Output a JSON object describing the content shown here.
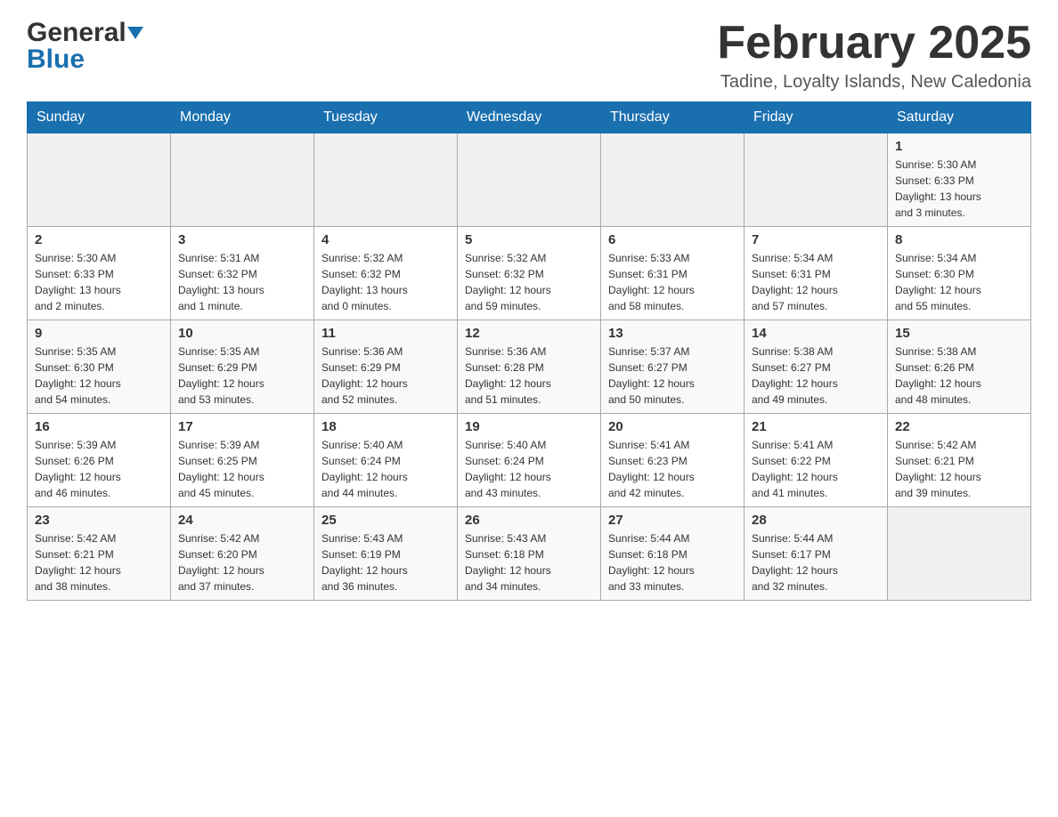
{
  "header": {
    "logo_general": "General",
    "logo_blue": "Blue",
    "month_title": "February 2025",
    "location": "Tadine, Loyalty Islands, New Caledonia"
  },
  "calendar": {
    "days_of_week": [
      "Sunday",
      "Monday",
      "Tuesday",
      "Wednesday",
      "Thursday",
      "Friday",
      "Saturday"
    ],
    "weeks": [
      [
        {
          "day": "",
          "info": ""
        },
        {
          "day": "",
          "info": ""
        },
        {
          "day": "",
          "info": ""
        },
        {
          "day": "",
          "info": ""
        },
        {
          "day": "",
          "info": ""
        },
        {
          "day": "",
          "info": ""
        },
        {
          "day": "1",
          "info": "Sunrise: 5:30 AM\nSunset: 6:33 PM\nDaylight: 13 hours\nand 3 minutes."
        }
      ],
      [
        {
          "day": "2",
          "info": "Sunrise: 5:30 AM\nSunset: 6:33 PM\nDaylight: 13 hours\nand 2 minutes."
        },
        {
          "day": "3",
          "info": "Sunrise: 5:31 AM\nSunset: 6:32 PM\nDaylight: 13 hours\nand 1 minute."
        },
        {
          "day": "4",
          "info": "Sunrise: 5:32 AM\nSunset: 6:32 PM\nDaylight: 13 hours\nand 0 minutes."
        },
        {
          "day": "5",
          "info": "Sunrise: 5:32 AM\nSunset: 6:32 PM\nDaylight: 12 hours\nand 59 minutes."
        },
        {
          "day": "6",
          "info": "Sunrise: 5:33 AM\nSunset: 6:31 PM\nDaylight: 12 hours\nand 58 minutes."
        },
        {
          "day": "7",
          "info": "Sunrise: 5:34 AM\nSunset: 6:31 PM\nDaylight: 12 hours\nand 57 minutes."
        },
        {
          "day": "8",
          "info": "Sunrise: 5:34 AM\nSunset: 6:30 PM\nDaylight: 12 hours\nand 55 minutes."
        }
      ],
      [
        {
          "day": "9",
          "info": "Sunrise: 5:35 AM\nSunset: 6:30 PM\nDaylight: 12 hours\nand 54 minutes."
        },
        {
          "day": "10",
          "info": "Sunrise: 5:35 AM\nSunset: 6:29 PM\nDaylight: 12 hours\nand 53 minutes."
        },
        {
          "day": "11",
          "info": "Sunrise: 5:36 AM\nSunset: 6:29 PM\nDaylight: 12 hours\nand 52 minutes."
        },
        {
          "day": "12",
          "info": "Sunrise: 5:36 AM\nSunset: 6:28 PM\nDaylight: 12 hours\nand 51 minutes."
        },
        {
          "day": "13",
          "info": "Sunrise: 5:37 AM\nSunset: 6:27 PM\nDaylight: 12 hours\nand 50 minutes."
        },
        {
          "day": "14",
          "info": "Sunrise: 5:38 AM\nSunset: 6:27 PM\nDaylight: 12 hours\nand 49 minutes."
        },
        {
          "day": "15",
          "info": "Sunrise: 5:38 AM\nSunset: 6:26 PM\nDaylight: 12 hours\nand 48 minutes."
        }
      ],
      [
        {
          "day": "16",
          "info": "Sunrise: 5:39 AM\nSunset: 6:26 PM\nDaylight: 12 hours\nand 46 minutes."
        },
        {
          "day": "17",
          "info": "Sunrise: 5:39 AM\nSunset: 6:25 PM\nDaylight: 12 hours\nand 45 minutes."
        },
        {
          "day": "18",
          "info": "Sunrise: 5:40 AM\nSunset: 6:24 PM\nDaylight: 12 hours\nand 44 minutes."
        },
        {
          "day": "19",
          "info": "Sunrise: 5:40 AM\nSunset: 6:24 PM\nDaylight: 12 hours\nand 43 minutes."
        },
        {
          "day": "20",
          "info": "Sunrise: 5:41 AM\nSunset: 6:23 PM\nDaylight: 12 hours\nand 42 minutes."
        },
        {
          "day": "21",
          "info": "Sunrise: 5:41 AM\nSunset: 6:22 PM\nDaylight: 12 hours\nand 41 minutes."
        },
        {
          "day": "22",
          "info": "Sunrise: 5:42 AM\nSunset: 6:21 PM\nDaylight: 12 hours\nand 39 minutes."
        }
      ],
      [
        {
          "day": "23",
          "info": "Sunrise: 5:42 AM\nSunset: 6:21 PM\nDaylight: 12 hours\nand 38 minutes."
        },
        {
          "day": "24",
          "info": "Sunrise: 5:42 AM\nSunset: 6:20 PM\nDaylight: 12 hours\nand 37 minutes."
        },
        {
          "day": "25",
          "info": "Sunrise: 5:43 AM\nSunset: 6:19 PM\nDaylight: 12 hours\nand 36 minutes."
        },
        {
          "day": "26",
          "info": "Sunrise: 5:43 AM\nSunset: 6:18 PM\nDaylight: 12 hours\nand 34 minutes."
        },
        {
          "day": "27",
          "info": "Sunrise: 5:44 AM\nSunset: 6:18 PM\nDaylight: 12 hours\nand 33 minutes."
        },
        {
          "day": "28",
          "info": "Sunrise: 5:44 AM\nSunset: 6:17 PM\nDaylight: 12 hours\nand 32 minutes."
        },
        {
          "day": "",
          "info": ""
        }
      ]
    ]
  }
}
